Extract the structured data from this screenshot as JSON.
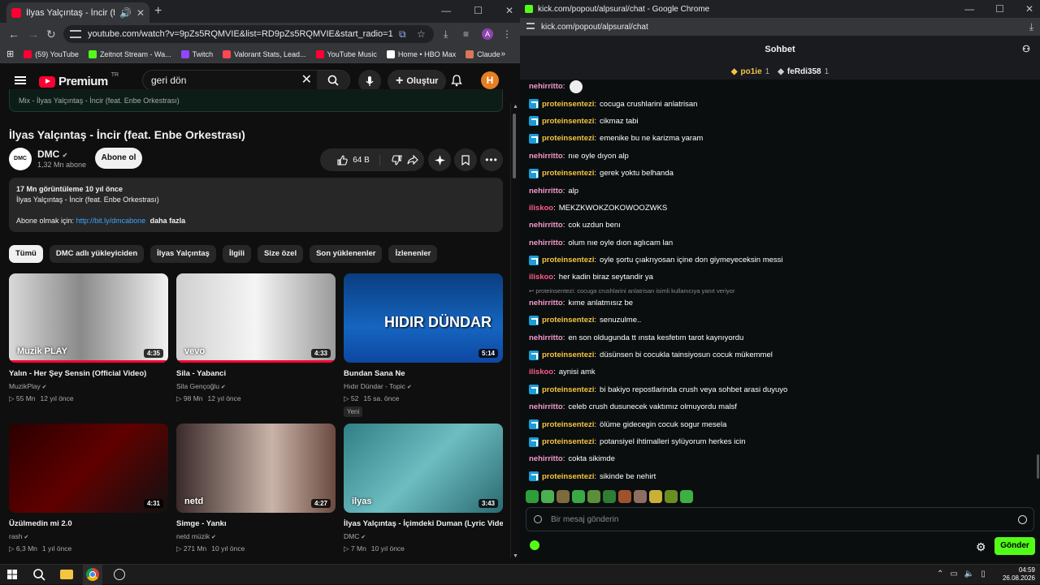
{
  "youtube_window": {
    "tab_title": "İlyas Yalçıntaş - İncir (feat. E",
    "url": "youtube.com/watch?v=9pZs5RQMVIE&list=RD9pZs5RQMVIE&start_radio=1",
    "bookmarks": [
      {
        "label": "(59) YouTube",
        "color": "#ff0033"
      },
      {
        "label": "Zeitnot Stream - Wa...",
        "color": "#53fc18"
      },
      {
        "label": "Twitch",
        "color": "#9146ff"
      },
      {
        "label": "Valorant Stats, Lead...",
        "color": "#ff4655"
      },
      {
        "label": "YouTube Music",
        "color": "#ff0033"
      },
      {
        "label": "Home • HBO Max",
        "color": "#ffffff"
      },
      {
        "label": "Claude",
        "color": "#d97757"
      }
    ],
    "profile_letter": "A",
    "header": {
      "logo_word": "Premium",
      "logo_sup": "TR",
      "search_value": "geri dön",
      "create_label": "Oluştur",
      "avatar_letter": "H"
    },
    "mix_label": "Mix - İlyas Yalçıntaş - İncir (feat. Enbe Orkestrası)",
    "video": {
      "title": "İlyas Yalçıntaş - İncir (feat. Enbe Orkestrası)",
      "channel_logo": "DMC",
      "channel": "DMC",
      "subscribers": "1,32 Mn abone",
      "subscribe_label": "Abone ol",
      "likes": "64 B"
    },
    "description": {
      "stats": "17 Mn görüntüleme  10 yıl önce",
      "line1": "İlyas Yalçıntaş - İncir (feat. Enbe Orkestrası)",
      "subscribe_prefix": "Abone olmak için:",
      "link": "http://bit.ly/dmcabone",
      "more": "daha fazla"
    },
    "chips": [
      "Tümü",
      "DMC adlı yükleyiciden",
      "İlyas Yalçıntaş",
      "İlgili",
      "Size özel",
      "Son yüklenenler",
      "İzlenenler"
    ],
    "videos": [
      {
        "title": "Yalın - Her Şey Sensin (Official Video)",
        "channel": "MuzikPlay",
        "views": "▷ 55 Mn",
        "age": "12 yıl önce",
        "duration": "4:35",
        "thumb_label": "Muzik PLAY",
        "bg": "linear-gradient(90deg,#d9d9d9,#8a8a8a 45%,#f2f2f2)",
        "progress": 1.0
      },
      {
        "title": "Sila - Yabanci",
        "channel": "Sila Gençoğlu",
        "views": "▷ 98 Mn",
        "age": "12 yıl önce",
        "duration": "4:33",
        "thumb_label": "vevo",
        "bg": "linear-gradient(90deg,#cfcfcf,#f5f5f5 50%,#9a9a9a)",
        "progress": 1.0
      },
      {
        "title": "Bundan Sana Ne",
        "channel": "Hıdır Dündar - Topic",
        "views": "▷ 52",
        "age": "15 sa. önce",
        "duration": "5:14",
        "thumb_label": "HIDIR DÜNDAR",
        "bg": "linear-gradient(180deg,#0a3d80,#1565c0 60%,#0d47a1)",
        "badge": "Yeni",
        "progress": 0
      },
      {
        "title": "Üzülmedin mi 2.0",
        "channel": "rash",
        "views": "▷ 6,3 Mn",
        "age": "1 yıl önce",
        "duration": "4:31",
        "thumb_label": "",
        "bg": "linear-gradient(135deg,#2a0000,#600000 50%,#111)",
        "progress": 0
      },
      {
        "title": "Simge - Yankı",
        "channel": "netd müzik",
        "views": "▷ 271 Mn",
        "age": "10 yıl önce",
        "duration": "4:27",
        "thumb_label": "netd",
        "bg": "linear-gradient(90deg,#3a2a2a,#c9b3a8 60%,#6a4a40)",
        "progress": 0
      },
      {
        "title": "İlyas Yalçıntaş - İçimdeki Duman (Lyric Video)",
        "channel": "DMC",
        "views": "▷ 7 Mn",
        "age": "10 yıl önce",
        "duration": "3:43",
        "thumb_label": "ilyas",
        "bg": "linear-gradient(135deg,#2f7f86,#6dbdc1 50%,#2a6a70)",
        "progress": 0
      }
    ]
  },
  "kick_window": {
    "title": "kick.com/popout/alpsural/chat - Google Chrome",
    "url": "kick.com/popout/alpsural/chat",
    "header": "Sohbet",
    "pinned": [
      {
        "name": "po1ie",
        "count": "1"
      },
      {
        "name": "feRdi358",
        "count": "1"
      }
    ],
    "reply_note": "↩ proteinsentezi: cocuga crushlarini anlatrisan isimli kullanıcıya yanıt veriyor",
    "messages": [
      {
        "user": "nehirritto",
        "color": "#f39acb",
        "text": "",
        "badge": false
      },
      {
        "user": "proteinsentezi",
        "color": "#f5c542",
        "text": "cocuga crushlarini anlatrisan",
        "badge": true
      },
      {
        "user": "proteinsentezi",
        "color": "#f5c542",
        "text": "cikmaz tabi",
        "badge": true
      },
      {
        "user": "proteinsentezi",
        "color": "#f5c542",
        "text": "emenike bu ne karizma yaram",
        "badge": true
      },
      {
        "user": "nehirritto",
        "color": "#f39acb",
        "text": "nıe oyle dıyon alp",
        "badge": false
      },
      {
        "user": "proteinsentezi",
        "color": "#f5c542",
        "text": "gerek yoktu belhanda",
        "badge": true
      },
      {
        "user": "nehirritto",
        "color": "#f39acb",
        "text": "alp",
        "badge": false
      },
      {
        "user": "iliskoo",
        "color": "#ff5a8a",
        "text": "MEKZKWOKZOKOWOOZWKS",
        "badge": false
      },
      {
        "user": "nehirritto",
        "color": "#f39acb",
        "text": "cok uzdun benı",
        "badge": false
      },
      {
        "user": "nehirritto",
        "color": "#f39acb",
        "text": "olum nıe oyle dıon aglıcam lan",
        "badge": false
      },
      {
        "user": "proteinsentezi",
        "color": "#f5c542",
        "text": "oyle şortu çıakrıyosan içine don giymeyeceksin messi",
        "badge": true
      },
      {
        "user": "iliskoo",
        "color": "#ff5a8a",
        "text": "her kadin biraz seytandir ya",
        "badge": false
      },
      {
        "user": "nehirritto",
        "color": "#f39acb",
        "text": "kıme anlatmısız be",
        "badge": false
      },
      {
        "user": "proteinsentezi",
        "color": "#f5c542",
        "text": "senuzulme..",
        "badge": true
      },
      {
        "user": "nehirritto",
        "color": "#f39acb",
        "text": "en son oldugunda tt ınsta kesfetım tarot kaynıyordu",
        "badge": false
      },
      {
        "user": "proteinsentezi",
        "color": "#f5c542",
        "text": "düsünsen bi cocukla tainsiyosun cocuk mükemmel",
        "badge": true
      },
      {
        "user": "iliskoo",
        "color": "#ff5a8a",
        "text": "aynisi amk",
        "badge": false
      },
      {
        "user": "proteinsentezi",
        "color": "#f5c542",
        "text": "bi bakiyo repostlarinda crush veya sohbet arasi duyuyo",
        "badge": true
      },
      {
        "user": "nehirritto",
        "color": "#f39acb",
        "text": "celeb crush dusunecek vaktımız olmuyordu malsf",
        "badge": false
      },
      {
        "user": "proteinsentezi",
        "color": "#f5c542",
        "text": "ölüme gidecegin cocuk sogur mesela",
        "badge": true
      },
      {
        "user": "proteinsentezi",
        "color": "#f5c542",
        "text": "potansiyel ihtimalleri sylüyorum herkes icin",
        "badge": true
      },
      {
        "user": "nehirritto",
        "color": "#f39acb",
        "text": "cokta sikimde",
        "badge": false
      },
      {
        "user": "proteinsentezi",
        "color": "#f5c542",
        "text": "sikinde be nehirt",
        "badge": true
      }
    ],
    "emote_colors": [
      "#2e9e3a",
      "#4caf50",
      "#7d6a3d",
      "#3aa845",
      "#5b8f3a",
      "#2e7d32",
      "#a0522d",
      "#8d6e63",
      "#c9b037",
      "#6b8e23",
      "#3cb043"
    ],
    "input_placeholder": "Bir mesaj gönderin",
    "send_label": "Gönder"
  },
  "taskbar": {
    "time": "04:59",
    "date": "26.08.2026"
  }
}
